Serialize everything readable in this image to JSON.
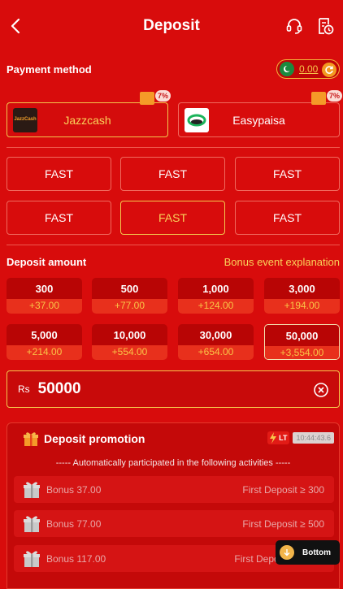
{
  "header": {
    "title": "Deposit"
  },
  "payment": {
    "label": "Payment method",
    "balance": "0.00",
    "methods": [
      {
        "name": "Jazzcash",
        "logo_text": "JazzCash",
        "badge": "7%"
      },
      {
        "name": "Easypaisa",
        "badge": "7%"
      }
    ]
  },
  "channels": [
    "FAST",
    "FAST",
    "FAST",
    "FAST",
    "FAST",
    "FAST"
  ],
  "amount": {
    "label": "Deposit amount",
    "bonus_link": "Bonus event explanation",
    "options": [
      {
        "value": "300",
        "bonus": "+37.00"
      },
      {
        "value": "500",
        "bonus": "+77.00"
      },
      {
        "value": "1,000",
        "bonus": "+124.00"
      },
      {
        "value": "3,000",
        "bonus": "+194.00"
      },
      {
        "value": "5,000",
        "bonus": "+214.00"
      },
      {
        "value": "10,000",
        "bonus": "+554.00"
      },
      {
        "value": "30,000",
        "bonus": "+654.00"
      },
      {
        "value": "50,000",
        "bonus": "+3,554.00"
      }
    ],
    "currency": "Rs",
    "input_value": "50000"
  },
  "promotion": {
    "title": "Deposit promotion",
    "tag": "LT",
    "timer": "10:44:43.6",
    "note": "----- Automatically participated in the following activities -----",
    "rows": [
      {
        "name": "Bonus 37.00",
        "condition": "First Deposit ≥ 300"
      },
      {
        "name": "Bonus 77.00",
        "condition": "First Deposit ≥ 500"
      },
      {
        "name": "Bonus 117.00",
        "condition": "First Deposit ≥ 1,000"
      }
    ]
  },
  "bottom_button": "Bottom",
  "colors": {
    "background": "#d80c0c",
    "accent_gold": "#f9d35a",
    "selected_border": "#f3c84d"
  }
}
